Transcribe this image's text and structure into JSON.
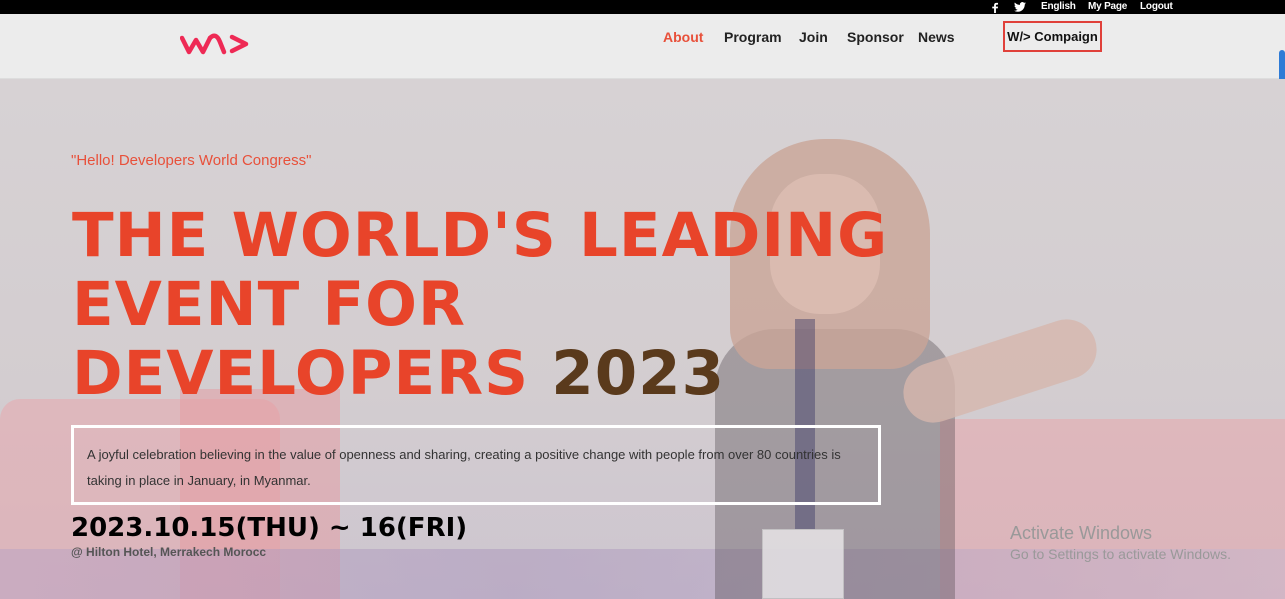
{
  "topbar": {
    "facebook_icon": "facebook-icon",
    "twitter_icon": "twitter-icon",
    "language": "English",
    "my_page": "My Page",
    "logout": "Logout"
  },
  "navbar": {
    "logo_text": "W>",
    "items": [
      {
        "label": "About",
        "active": true
      },
      {
        "label": "Program"
      },
      {
        "label": "Join"
      },
      {
        "label": "Sponsor"
      },
      {
        "label": "News"
      }
    ],
    "campaign_label": "W/> Compaign",
    "accent_color": "#e8503a"
  },
  "hero": {
    "tagline": "\"Hello! Developers World Congress\"",
    "headline_line1": "THE WORLD'S LEADING",
    "headline_line2": "EVENT FOR",
    "headline_line3": "DEVELOPERS",
    "headline_year": "2023",
    "description": "A joyful celebration believing in the value of openness and sharing, creating a positive change with people from over 80 countries is taking in place in January, in Myanmar.",
    "date": "2023.10.15(THU) ~ 16(FRI)",
    "venue": "@ Hilton Hotel, Merrakech Morocc"
  },
  "watermark": {
    "title": "Activate Windows",
    "subtitle": "Go to Settings to activate Windows."
  }
}
